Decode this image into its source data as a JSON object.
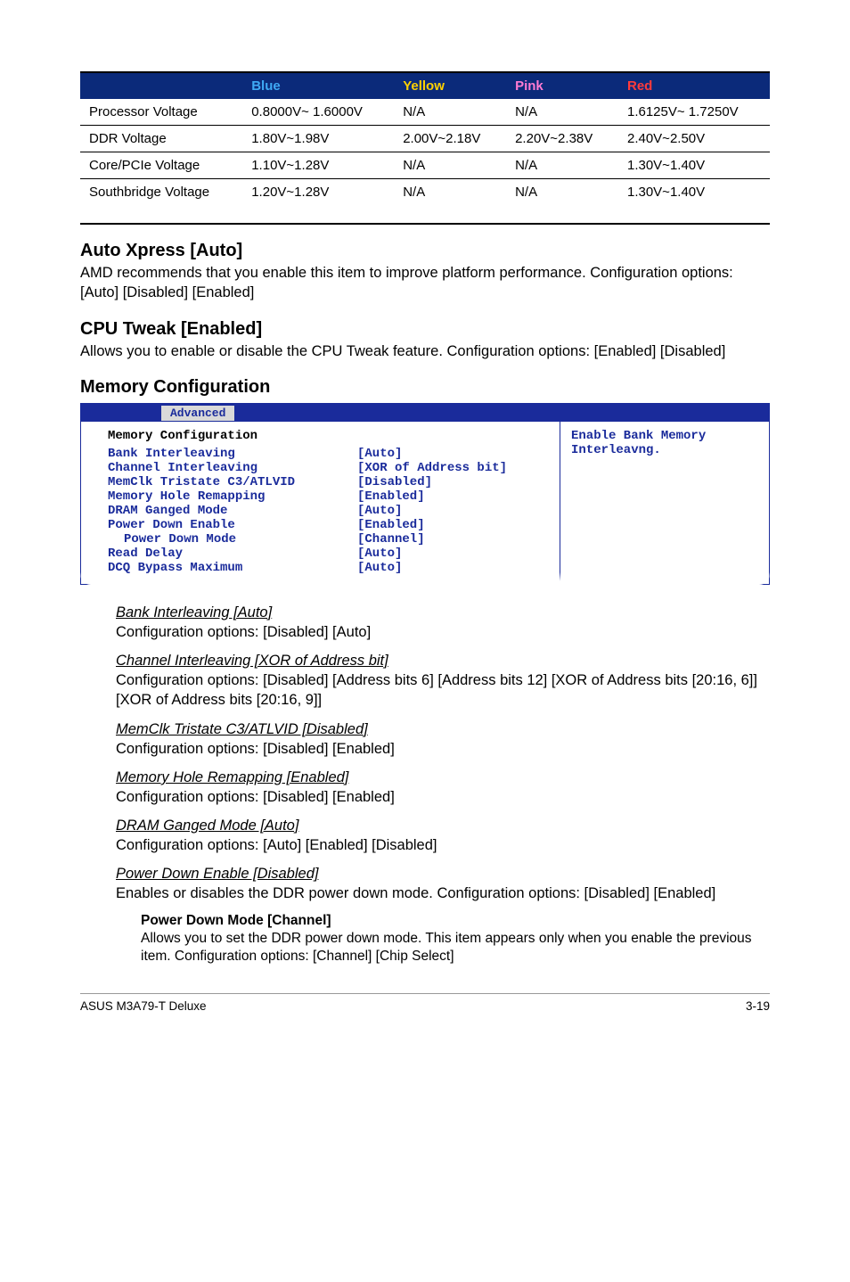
{
  "chart_data": {
    "type": "table",
    "columns": [
      "",
      "Blue",
      "Yellow",
      "Pink",
      "Red"
    ],
    "rows": [
      [
        "Processor Voltage",
        "0.8000V~ 1.6000V",
        "N/A",
        "N/A",
        "1.6125V~ 1.7250V"
      ],
      [
        "DDR Voltage",
        "1.80V~1.98V",
        "2.00V~2.18V",
        "2.20V~2.38V",
        "2.40V~2.50V"
      ],
      [
        "Core/PCIe Voltage",
        "1.10V~1.28V",
        "N/A",
        "N/A",
        "1.30V~1.40V"
      ],
      [
        "Southbridge Voltage",
        "1.20V~1.28V",
        "N/A",
        "N/A",
        "1.30V~1.40V"
      ]
    ]
  },
  "table": {
    "headers": {
      "blank": "",
      "blue": "Blue",
      "yellow": "Yellow",
      "pink": "Pink",
      "red": "Red"
    },
    "rows": [
      {
        "label": "Processor Voltage",
        "blue": "0.8000V~ 1.6000V",
        "yellow": "N/A",
        "pink": "N/A",
        "red": "1.6125V~ 1.7250V"
      },
      {
        "label": "DDR Voltage",
        "blue": "1.80V~1.98V",
        "yellow": "2.00V~2.18V",
        "pink": "2.20V~2.38V",
        "red": "2.40V~2.50V"
      },
      {
        "label": "Core/PCIe Voltage",
        "blue": "1.10V~1.28V",
        "yellow": "N/A",
        "pink": "N/A",
        "red": "1.30V~1.40V"
      },
      {
        "label": "Southbridge Voltage",
        "blue": "1.20V~1.28V",
        "yellow": "N/A",
        "pink": "N/A",
        "red": "1.30V~1.40V"
      }
    ]
  },
  "sections": {
    "auto_xpress": {
      "title": "Auto Xpress [Auto]",
      "desc": "AMD recommends that you enable this item to improve platform performance. Configuration options: [Auto] [Disabled] [Enabled]"
    },
    "cpu_tweak": {
      "title": "CPU Tweak [Enabled]",
      "desc": "Allows you to enable or disable the CPU Tweak feature. Configuration options: [Enabled] [Disabled]"
    },
    "mem_config": {
      "title": "Memory Configuration"
    }
  },
  "bios": {
    "tab": "Advanced",
    "heading": "Memory Configuration",
    "help": "Enable Bank Memory Interleavng.",
    "rows": [
      {
        "k": "Bank Interleaving",
        "v": "[Auto]"
      },
      {
        "k": "Channel Interleaving",
        "v": "[XOR of Address bit]"
      },
      {
        "k": "MemClk Tristate C3/ATLVID",
        "v": "[Disabled]"
      },
      {
        "k": "Memory Hole Remapping",
        "v": "[Enabled]"
      },
      {
        "k": "DRAM Ganged Mode",
        "v": "[Auto]"
      },
      {
        "k": "Power Down Enable",
        "v": "[Enabled]"
      },
      {
        "k": "Power Down Mode",
        "v": "[Channel]",
        "indent": true
      },
      {
        "k": "Read Delay",
        "v": "[Auto]"
      },
      {
        "k": "DCQ Bypass Maximum",
        "v": "[Auto]"
      }
    ]
  },
  "items": {
    "bank": {
      "t": "Bank Interleaving [Auto]",
      "d": "Configuration options: [Disabled] [Auto]"
    },
    "chan": {
      "t": "Channel Interleaving [XOR of Address bit]",
      "d": "Configuration options: [Disabled] [Address bits 6] [Address bits 12] [XOR of Address bits [20:16, 6]] [XOR of Address bits [20:16, 9]]"
    },
    "memclk": {
      "t": "MemClk Tristate C3/ATLVID [Disabled]",
      "d": "Configuration options: [Disabled] [Enabled]"
    },
    "hole": {
      "t": "Memory Hole Remapping [Enabled]",
      "d": "Configuration options: [Disabled] [Enabled]"
    },
    "ganged": {
      "t": "DRAM Ganged Mode [Auto]",
      "d": "Configuration options: [Auto] [Enabled] [Disabled]"
    },
    "pde": {
      "t": "Power Down Enable [Disabled]",
      "d": "Enables or disables the DDR power down mode. Configuration options: [Disabled] [Enabled]"
    },
    "pdm": {
      "t": "Power Down Mode [Channel]",
      "d": "Allows you to set the DDR power down mode. This item appears only when you enable the previous item. Configuration options: [Channel] [Chip Select]"
    }
  },
  "footer": {
    "left": "ASUS M3A79-T Deluxe",
    "right": "3-19"
  }
}
